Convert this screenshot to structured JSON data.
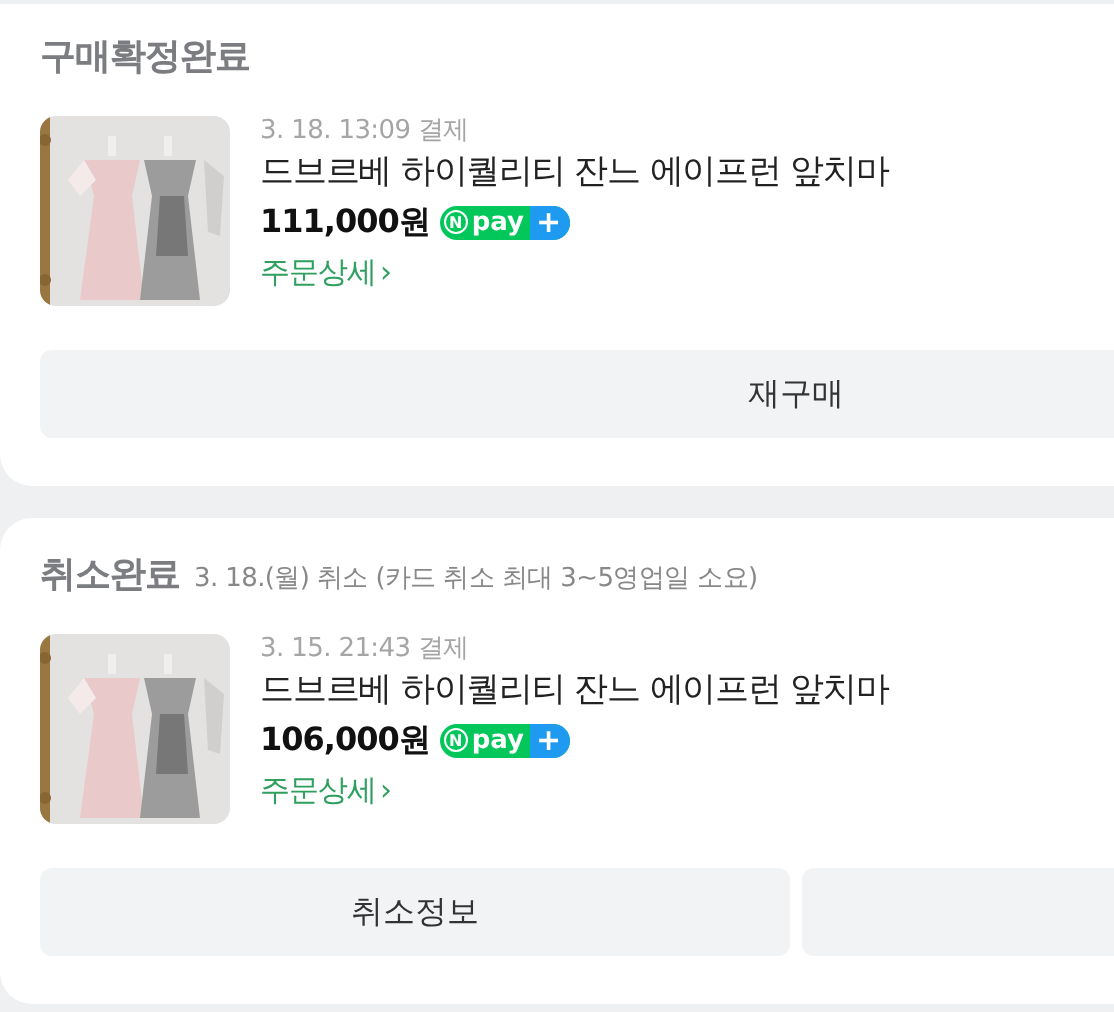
{
  "orders": [
    {
      "status": "구매확정완료",
      "paid_at": "3. 18. 13:09 결제",
      "product": "드브르베 하이퀄리티 잔느 에이프런 앞치마",
      "price": "111,000원",
      "pay_badge": {
        "mark": "N",
        "label": "pay",
        "plus": "+"
      },
      "detail_link": "주문상세",
      "detail_arrow": "›",
      "thumbnail": {
        "kind": "picture"
      },
      "buttons": [
        {
          "label": "재구매"
        }
      ]
    },
    {
      "status": "취소완료",
      "status_note": "3. 18.(월) 취소 (카드 취소 최대 3~5영업일 소요)",
      "paid_at": "3. 15. 21:43 결제",
      "product": "드브르베 하이퀄리티 잔느 에이프런 앞치마",
      "price": "106,000원",
      "pay_badge": {
        "mark": "N",
        "label": "pay",
        "plus": "+"
      },
      "detail_link": "주문상세",
      "detail_arrow": "›",
      "thumbnail": {
        "kind": "picture"
      },
      "buttons": [
        {
          "label": "취소정보"
        },
        {
          "kind": "cut_off"
        }
      ]
    }
  ]
}
